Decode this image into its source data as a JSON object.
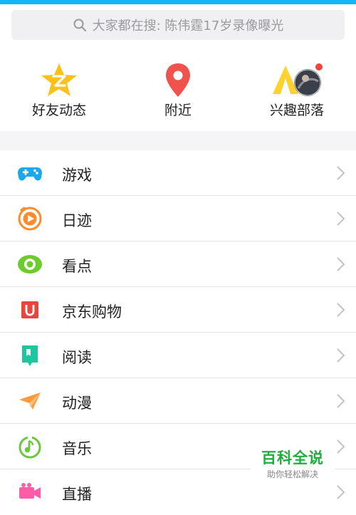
{
  "search": {
    "placeholder": "大家都在搜: 陈伟霆17岁录像曝光"
  },
  "quick_entries": [
    {
      "label": "好友动态",
      "icon": "qzone-star-icon",
      "color": "#f9c21b"
    },
    {
      "label": "附近",
      "icon": "location-pin-icon",
      "color": "#f0524d"
    },
    {
      "label": "兴趣部落",
      "icon": "tribe-tent-icon",
      "color": "#ffd22e",
      "has_badge": true
    }
  ],
  "menu": [
    {
      "label": "游戏",
      "icon": "gamepad-icon",
      "color": "#1aa7ec"
    },
    {
      "label": "日迹",
      "icon": "daily-trace-icon",
      "color": "#ff8a2b"
    },
    {
      "label": "看点",
      "icon": "eye-icon",
      "color": "#6ccc2c"
    },
    {
      "label": "京东购物",
      "icon": "jd-shopping-icon",
      "color": "#e8463c"
    },
    {
      "label": "阅读",
      "icon": "book-icon",
      "color": "#1cc7a0"
    },
    {
      "label": "动漫",
      "icon": "paper-plane-icon",
      "color": "#ff9a3a"
    },
    {
      "label": "音乐",
      "icon": "music-note-icon",
      "color": "#6dc640"
    },
    {
      "label": "直播",
      "icon": "video-camera-icon",
      "color": "#ff5ba6"
    }
  ],
  "watermark": {
    "title": "百科全说",
    "subtitle": "助你轻松解决"
  },
  "colors": {
    "accent": "#12b7f5",
    "badge": "#f5453a"
  }
}
